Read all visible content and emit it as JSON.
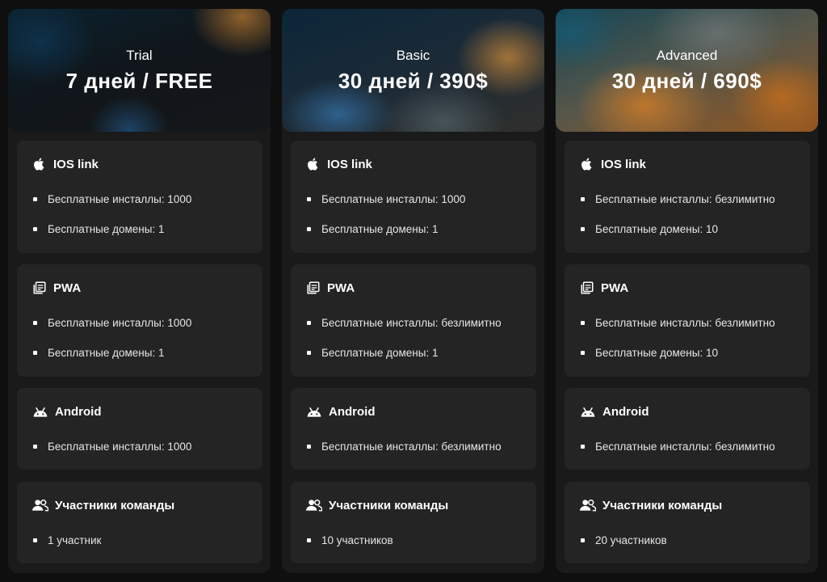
{
  "plans": [
    {
      "name": "Trial",
      "price": "7 дней / FREE",
      "sections": [
        {
          "icon": "apple-icon",
          "title": "IOS link",
          "features": [
            "Бесплатные инсталлы: 1000",
            "Бесплатные домены: 1"
          ]
        },
        {
          "icon": "pwa-icon",
          "title": "PWA",
          "features": [
            "Бесплатные инсталлы: 1000",
            "Бесплатные домены: 1"
          ]
        },
        {
          "icon": "android-icon",
          "title": "Android",
          "features": [
            "Бесплатные инсталлы: 1000"
          ]
        },
        {
          "icon": "team-icon",
          "title": "Участники команды",
          "features": [
            "1 участник"
          ]
        }
      ]
    },
    {
      "name": "Basic",
      "price": "30 дней / 390$",
      "sections": [
        {
          "icon": "apple-icon",
          "title": "IOS link",
          "features": [
            "Бесплатные инсталлы: 1000",
            "Бесплатные домены: 1"
          ]
        },
        {
          "icon": "pwa-icon",
          "title": "PWA",
          "features": [
            "Бесплатные инсталлы: безлимитно",
            "Бесплатные домены: 1"
          ]
        },
        {
          "icon": "android-icon",
          "title": "Android",
          "features": [
            "Бесплатные инсталлы: безлимитно"
          ]
        },
        {
          "icon": "team-icon",
          "title": "Участники команды",
          "features": [
            "10 участников"
          ]
        }
      ]
    },
    {
      "name": "Advanced",
      "price": "30 дней / 690$",
      "sections": [
        {
          "icon": "apple-icon",
          "title": "IOS link",
          "features": [
            "Бесплатные инсталлы: безлимитно",
            "Бесплатные домены: 10"
          ]
        },
        {
          "icon": "pwa-icon",
          "title": "PWA",
          "features": [
            "Бесплатные инсталлы: безлимитно",
            "Бесплатные домены: 10"
          ]
        },
        {
          "icon": "android-icon",
          "title": "Android",
          "features": [
            "Бесплатные инсталлы: безлимитно"
          ]
        },
        {
          "icon": "team-icon",
          "title": "Участники команды",
          "features": [
            "20 участников"
          ]
        }
      ]
    }
  ],
  "colors": {
    "background": "#0f0f0f",
    "panel": "#1a1a1a",
    "card": "#242424",
    "text": "#ffffff"
  }
}
